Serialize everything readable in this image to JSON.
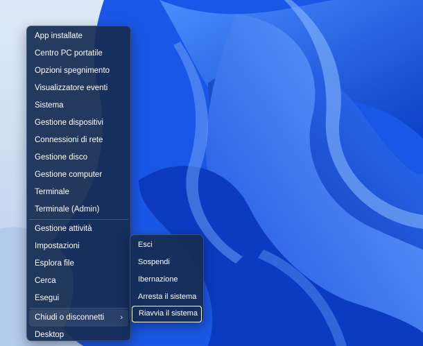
{
  "context_menu": {
    "group1": [
      {
        "label": "App installate"
      },
      {
        "label": "Centro PC portatile"
      },
      {
        "label": "Opzioni spegnimento"
      },
      {
        "label": "Visualizzatore eventi"
      },
      {
        "label": "Sistema"
      },
      {
        "label": "Gestione dispositivi"
      },
      {
        "label": "Connessioni di rete"
      },
      {
        "label": "Gestione disco"
      },
      {
        "label": "Gestione computer"
      },
      {
        "label": "Terminale"
      },
      {
        "label": "Terminale (Admin)"
      }
    ],
    "group2": [
      {
        "label": "Gestione attività"
      },
      {
        "label": "Impostazioni"
      },
      {
        "label": "Esplora file"
      },
      {
        "label": "Cerca"
      },
      {
        "label": "Esegui"
      }
    ],
    "group3": [
      {
        "label": "Chiudi o disconnetti",
        "has_submenu": true,
        "chevron": "›"
      },
      {
        "label": "Desktop"
      }
    ]
  },
  "submenu": {
    "items": [
      {
        "label": "Esci"
      },
      {
        "label": "Sospendi"
      },
      {
        "label": "Ibernazione"
      },
      {
        "label": "Arresta il sistema"
      },
      {
        "label": "Riavvia il sistema",
        "focused": true
      }
    ]
  },
  "colors": {
    "menu_background": "#162c52",
    "menu_text": "#ffffff",
    "wallpaper_accent": "#1a5cf0",
    "wallpaper_background": "#cfe0f4"
  }
}
